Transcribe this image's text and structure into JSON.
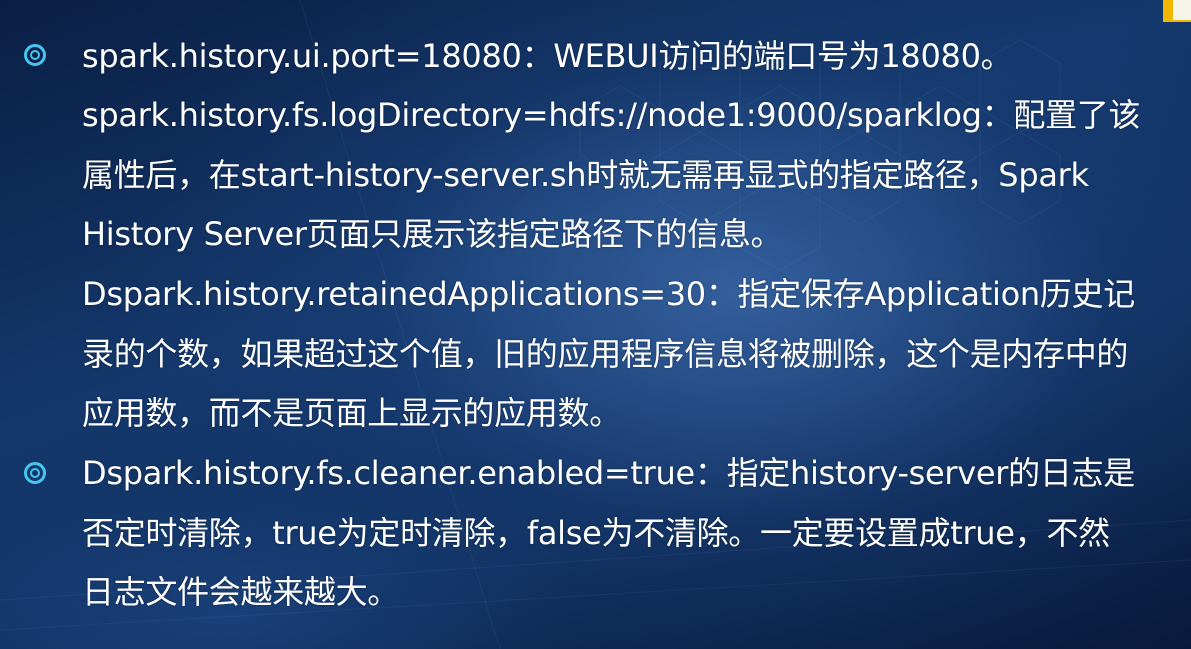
{
  "slide": {
    "bullet_marker": "double-circle-bullet-icon",
    "accent_color": "#46c6ef",
    "corner_accent_color": "#f2b705",
    "paragraphs": [
      {
        "has_bullet": true,
        "lines": [
          "spark.history.ui.port=18080：WEBUI访问的端口号为18080。"
        ]
      },
      {
        "has_bullet": false,
        "lines": [
          "spark.history.fs.logDirectory=hdfs://node1:9000/sparklog：配置了该",
          "属性后，在start-history-server.sh时就无需再显式的指定路径，Spark",
          "History Server页面只展示该指定路径下的信息。"
        ]
      },
      {
        "has_bullet": false,
        "lines": [
          "Dspark.history.retainedApplications=30：指定保存Application历史记",
          "录的个数，如果超过这个值，旧的应用程序信息将被删除，这个是内存中的",
          "应用数，而不是页面上显示的应用数。"
        ]
      },
      {
        "has_bullet": true,
        "lines": [
          "Dspark.history.fs.cleaner.enabled=true：指定history-server的日志是",
          "否定时清除，true为定时清除，false为不清除。一定要设置成true，不然",
          "日志文件会越来越大。"
        ]
      }
    ]
  }
}
